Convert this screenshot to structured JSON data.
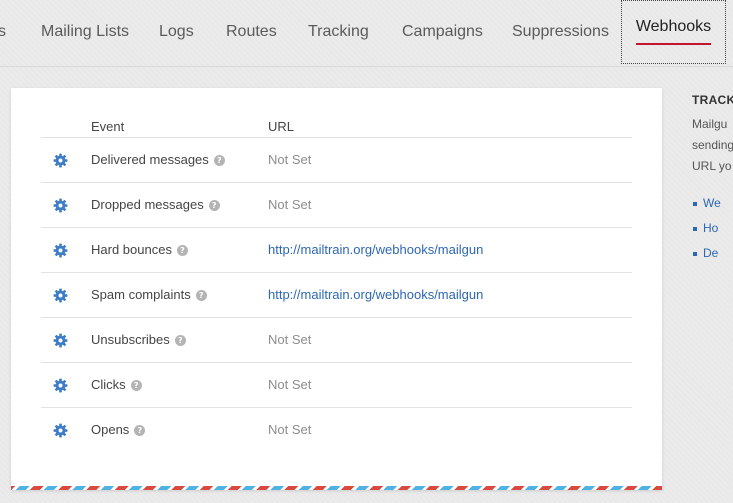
{
  "nav": {
    "tabs": [
      {
        "label": "s"
      },
      {
        "label": "Mailing Lists"
      },
      {
        "label": "Logs"
      },
      {
        "label": "Routes"
      },
      {
        "label": "Tracking"
      },
      {
        "label": "Campaigns"
      },
      {
        "label": "Suppressions"
      },
      {
        "label": "Webhooks",
        "active": true
      }
    ]
  },
  "table": {
    "headers": {
      "event": "Event",
      "url": "URL"
    },
    "rows": [
      {
        "event": "Delivered messages",
        "url": "Not Set",
        "set": false
      },
      {
        "event": "Dropped messages",
        "url": "Not Set",
        "set": false
      },
      {
        "event": "Hard bounces",
        "url": "http://mailtrain.org/webhooks/mailgun",
        "set": true
      },
      {
        "event": "Spam complaints",
        "url": "http://mailtrain.org/webhooks/mailgun",
        "set": true
      },
      {
        "event": "Unsubscribes",
        "url": "Not Set",
        "set": false
      },
      {
        "event": "Clicks",
        "url": "Not Set",
        "set": false
      },
      {
        "event": "Opens",
        "url": "Not Set",
        "set": false
      }
    ],
    "help_glyph": "?",
    "row_icon": "gear-icon",
    "help_icon": "question-circle-icon"
  },
  "sidebar": {
    "title": "TRACK",
    "text_lines": [
      "Mailgu",
      "sending",
      "URL yo"
    ],
    "links": [
      "We",
      "Ho",
      "De"
    ]
  },
  "colors": {
    "accent": "#c41231",
    "link": "#2d67b3",
    "gear": "#3d7cc9",
    "muted": "#8d8d8d"
  }
}
